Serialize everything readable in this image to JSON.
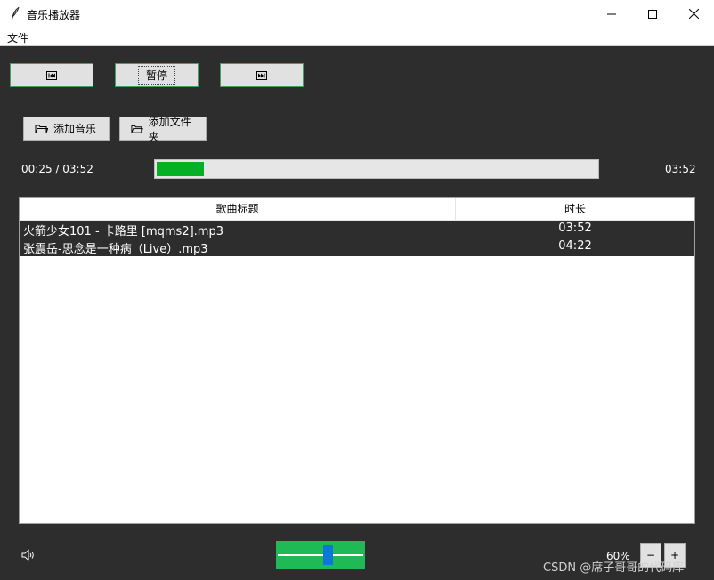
{
  "window": {
    "title": "音乐播放器",
    "icon": "feather-icon"
  },
  "menu": {
    "file": "文件"
  },
  "controls": {
    "pause_label": "暂停",
    "prev_icon": "skip-previous-icon",
    "next_icon": "skip-next-icon"
  },
  "library": {
    "add_music": "添加音乐",
    "add_folder": "添加文件夹"
  },
  "progress": {
    "elapsed_display": "00:25 / 03:52",
    "total": "03:52",
    "fraction": 0.108
  },
  "table": {
    "headers": [
      "歌曲标题",
      "时长"
    ],
    "rows": [
      {
        "title": "火箭少女101 - 卡路里 [mqms2].mp3",
        "duration": "03:52"
      },
      {
        "title": "张震岳-思念是一种病（Live）.mp3",
        "duration": "04:22"
      }
    ]
  },
  "volume": {
    "percent_label": "60%",
    "value": 0.6,
    "minus": "−",
    "plus": "+"
  },
  "colors": {
    "background": "#2d2d2d",
    "progress_fill": "#06b025",
    "volume_bg": "#1fba55",
    "slider_thumb": "#0a78d7",
    "button_border": "#3fa35f"
  },
  "watermark": "CSDN @席子哥哥的代码库"
}
